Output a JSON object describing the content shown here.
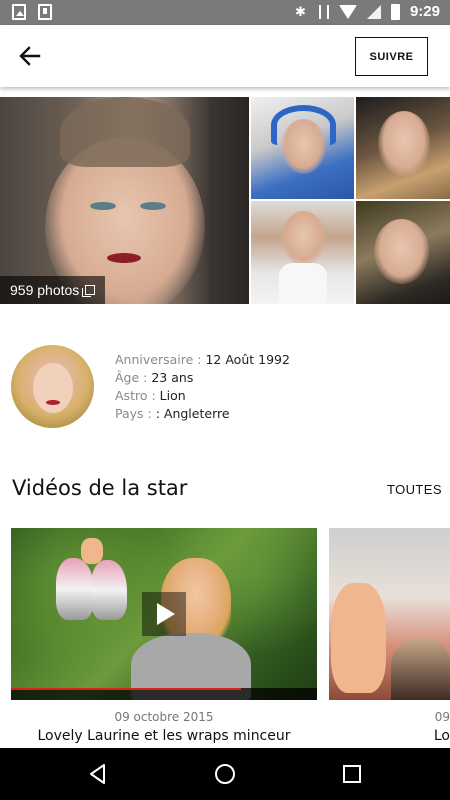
{
  "status_bar": {
    "time": "9:29",
    "left_icons": [
      "image-icon",
      "download-icon"
    ],
    "right_icons": [
      "bluetooth-icon",
      "vibrate-icon",
      "wifi-icon",
      "signal-icon",
      "battery-icon"
    ]
  },
  "app_bar": {
    "back_icon": "arrow-left-icon",
    "follow_label": "SUIVRE"
  },
  "gallery": {
    "photo_count": "959 photos"
  },
  "star_info": {
    "birthday_label": "Anniversaire :",
    "birthday_value": "12 Août 1992",
    "age_label": "Âge :",
    "age_value": "23 ans",
    "astro_label": "Astro :",
    "astro_value": "Lion",
    "country_label": "Pays :",
    "country_value": ": Angleterre"
  },
  "videos": {
    "section_title": "Vidéos de la star",
    "all_label": "TOUTES",
    "items": [
      {
        "date": "09 octobre 2015",
        "title": "Lovely Laurine et les wraps minceur",
        "progress": 0.75
      },
      {
        "date": "09",
        "title": "Lo"
      }
    ]
  },
  "nav_bar": {
    "icons": [
      "nav-back-icon",
      "nav-home-icon",
      "nav-recent-icon"
    ]
  }
}
